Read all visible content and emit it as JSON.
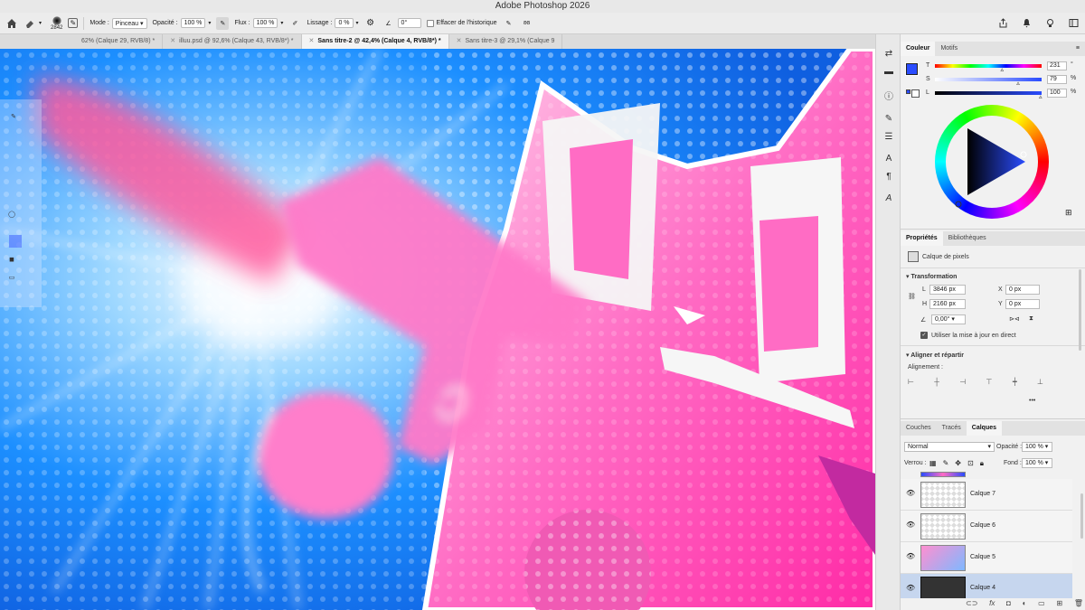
{
  "window": {
    "title": "Adobe Photoshop 2026"
  },
  "options_bar": {
    "brush_size": "2842",
    "mode_label": "Mode :",
    "mode_value": "Pinceau",
    "opacity_label": "Opacité :",
    "opacity_value": "100 %",
    "flow_label": "Flux :",
    "flow_value": "100 %",
    "smoothing_label": "Lissage :",
    "smoothing_value": "0 %",
    "angle_value": "0°",
    "erase_history_label": "Effacer de l'historique"
  },
  "tabs": [
    {
      "label": "62% (Calque 29, RVB/8) *",
      "active": false
    },
    {
      "label": "illuu.psd @ 92,6% (Calque 43, RVB/8*) *",
      "active": false
    },
    {
      "label": "Sans titre-2 @ 42,4% (Calque 4, RVB/8*) *",
      "active": true
    },
    {
      "label": "Sans titre-3 @ 29,1% (Calque 9",
      "active": false
    }
  ],
  "color_panel": {
    "tabs": [
      "Couleur",
      "Motifs"
    ],
    "h_label": "T",
    "h_value": "231",
    "h_unit": "°",
    "s_label": "S",
    "s_value": "79",
    "s_unit": "%",
    "l_label": "L",
    "l_value": "100",
    "l_unit": "%",
    "foreground_color": "#2a4cff",
    "background_color": "#ffffff",
    "h_fraction": 0.64,
    "s_fraction": 0.79,
    "l_fraction": 1.0
  },
  "properties_panel": {
    "tabs": [
      "Propriétés",
      "Bibliothèques"
    ],
    "layer_kind": "Calque de pixels",
    "transform_heading": "Transformation",
    "w_label": "L",
    "w_value": "3846 px",
    "h_label": "H",
    "h_value": "2160 px",
    "x_label": "X",
    "x_value": "0 px",
    "y_label": "Y",
    "y_value": "0 px",
    "angle_value": "0,00°",
    "live_update_label": "Utiliser la mise à jour en direct",
    "align_heading": "Aligner et répartir",
    "align_label": "Alignement :",
    "more_label": "•••"
  },
  "layers_panel": {
    "tabs": [
      "Couches",
      "Tracés",
      "Calques"
    ],
    "blend_mode": "Normal",
    "opacity_label": "Opacité :",
    "opacity_value": "100 %",
    "lock_label": "Verrou :",
    "fill_label": "Fond :",
    "fill_value": "100 %",
    "layers": [
      {
        "name": "Calque 7",
        "selected": false
      },
      {
        "name": "Calque 6",
        "selected": false
      },
      {
        "name": "Calque 5",
        "selected": false
      },
      {
        "name": "Calque 4",
        "selected": true
      }
    ]
  },
  "icons": {
    "home": "home-icon",
    "eraser": "eraser-icon",
    "share": "share-icon",
    "bell": "bell-icon",
    "lightbulb": "lightbulb-icon",
    "workspace": "workspace-icon"
  },
  "colors": {
    "accent": "#2a4cff",
    "canvas_blue": "#1a8ff0",
    "canvas_pink": "#ff3fb0",
    "selected_layer": "#c6d6ee"
  }
}
